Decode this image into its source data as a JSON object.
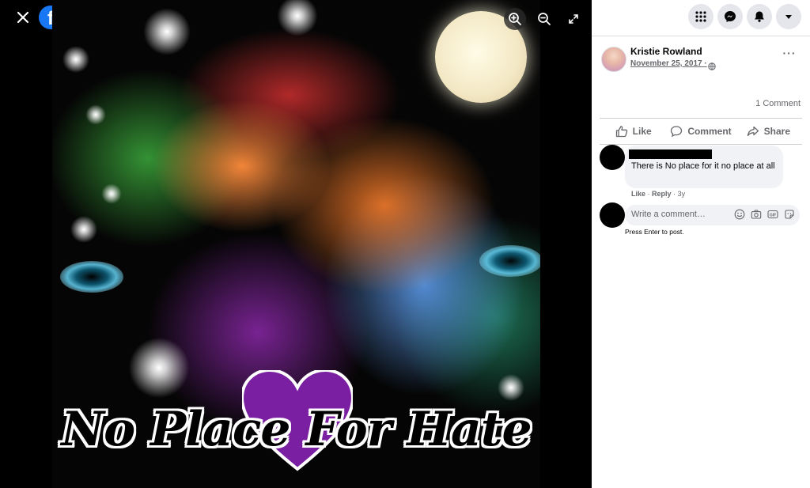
{
  "viewer": {
    "brand_logo": "facebook-logo",
    "brand_letter": "f",
    "image_text": "No Place For Hate",
    "tools": [
      "zoom-in-icon",
      "zoom-out-icon",
      "fullscreen-icon"
    ]
  },
  "topbar": {
    "icons": [
      "menu-grid-icon",
      "messenger-icon",
      "notifications-bell-icon",
      "account-dropdown-icon"
    ]
  },
  "post": {
    "author": "Kristie Rowland",
    "date": "November 25, 2017",
    "separator": "·",
    "privacy_icon": "globe-icon",
    "comment_count": "1 Comment"
  },
  "actions": {
    "like": "Like",
    "comment": "Comment",
    "share": "Share"
  },
  "comment": {
    "text": "There is No place for it no place at all",
    "like": "Like",
    "dot": "·",
    "reply": "Reply",
    "age": "3y"
  },
  "composer": {
    "placeholder": "Write a comment…",
    "hint": "Press Enter to post.",
    "icons": [
      "emoji-icon",
      "camera-icon",
      "gif-icon",
      "sticker-icon"
    ]
  },
  "colors": {
    "brand": "#1877f2",
    "panel_bg": "#ffffff",
    "button_gray": "#e4e6eb",
    "bubble_gray": "#f0f2f5",
    "secondary_text": "#65676b"
  }
}
